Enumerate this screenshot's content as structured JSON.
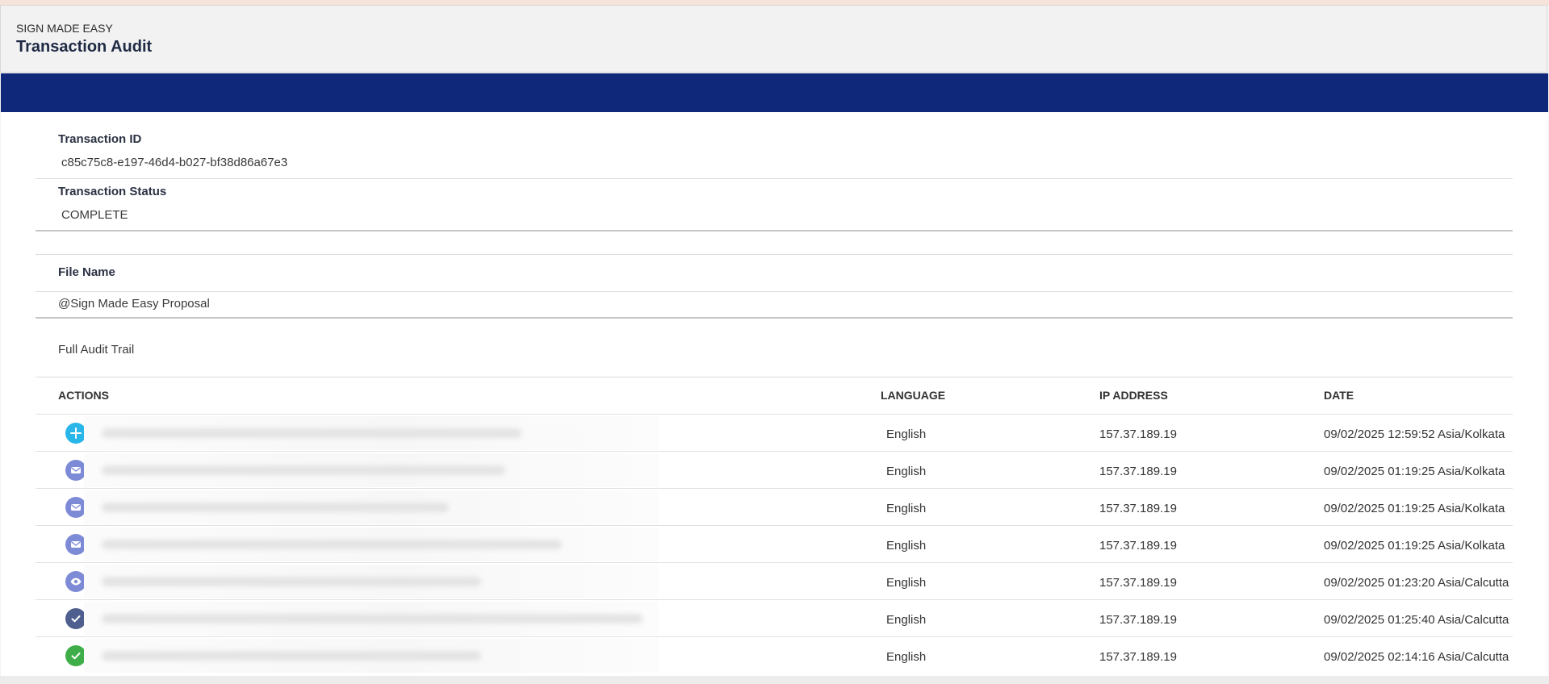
{
  "header": {
    "brand": "SIGN MADE EASY",
    "title": "Transaction Audit"
  },
  "colors": {
    "band": "#10287a",
    "add": "#29b6e8",
    "mail": "#7d8ad6",
    "view": "#7d8ad6",
    "sign": "#4e5f8f",
    "complete": "#3fae49"
  },
  "transaction": {
    "id_label": "Transaction ID",
    "id_value": "c85c75c8-e197-46d4-b027-bf38d86a67e3",
    "status_label": "Transaction Status",
    "status_value": "COMPLETE"
  },
  "file": {
    "label": "File Name",
    "value": "@Sign Made Easy Proposal"
  },
  "audit": {
    "section_title": "Full Audit Trail",
    "columns": {
      "actions": "ACTIONS",
      "language": "LANGUAGE",
      "ip": "IP ADDRESS",
      "date": "DATE"
    },
    "rows": [
      {
        "icon": "plus-icon",
        "language": "English",
        "ip": "157.37.189.19",
        "date": "09/02/2025 12:59:52 Asia/Kolkata"
      },
      {
        "icon": "mail-icon",
        "language": "English",
        "ip": "157.37.189.19",
        "date": "09/02/2025 01:19:25 Asia/Kolkata"
      },
      {
        "icon": "mail-icon",
        "language": "English",
        "ip": "157.37.189.19",
        "date": "09/02/2025 01:19:25 Asia/Kolkata"
      },
      {
        "icon": "mail-icon",
        "language": "English",
        "ip": "157.37.189.19",
        "date": "09/02/2025 01:19:25 Asia/Kolkata"
      },
      {
        "icon": "eye-icon",
        "language": "English",
        "ip": "157.37.189.19",
        "date": "09/02/2025 01:23:20 Asia/Calcutta"
      },
      {
        "icon": "check-icon",
        "language": "English",
        "ip": "157.37.189.19",
        "date": "09/02/2025 01:25:40 Asia/Calcutta"
      },
      {
        "icon": "check-circle-icon",
        "language": "English",
        "ip": "157.37.189.19",
        "date": "09/02/2025 02:14:16 Asia/Calcutta"
      }
    ]
  }
}
